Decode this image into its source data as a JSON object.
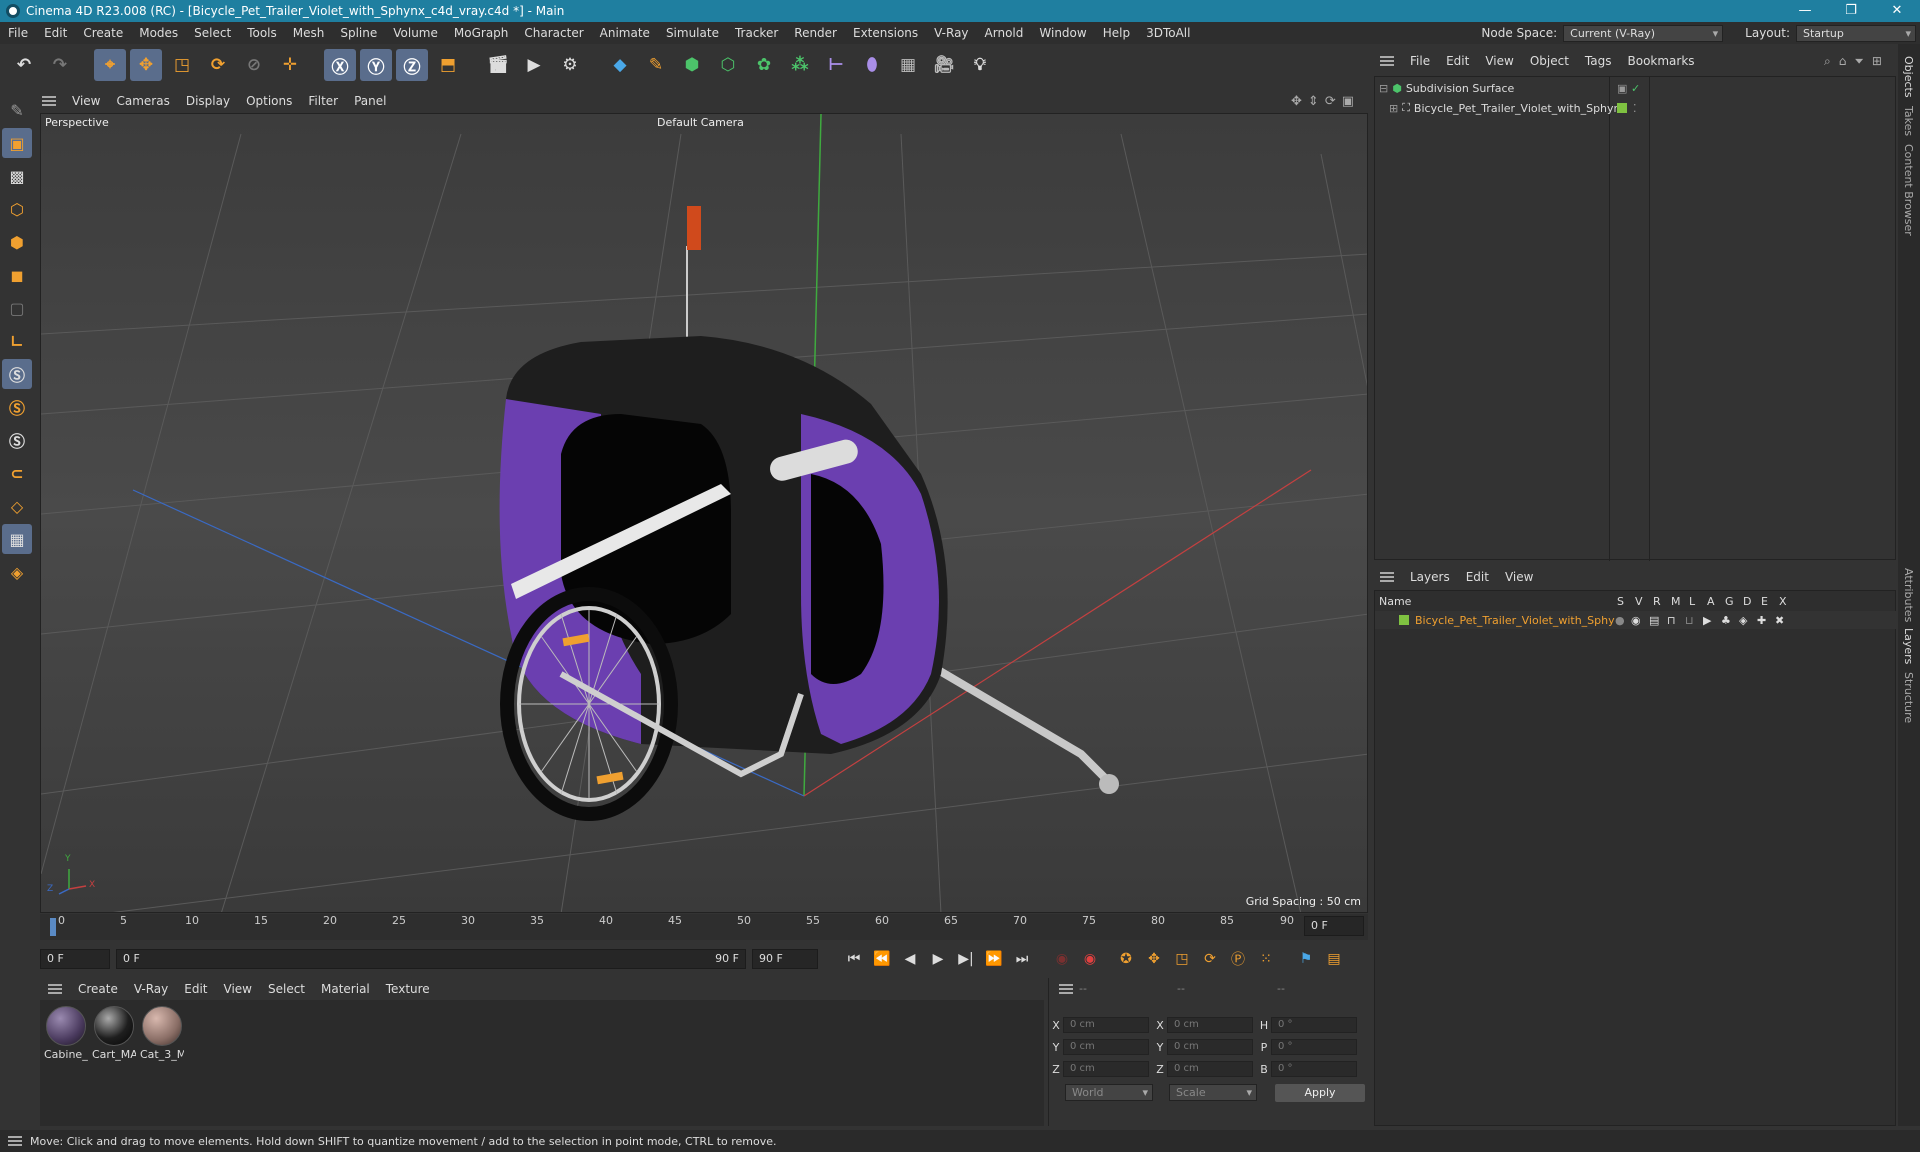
{
  "title": {
    "text": "Cinema 4D R23.008 (RC) - [Bicycle_Pet_Trailer_Violet_with_Sphynx_c4d_vray.c4d *] - Main"
  },
  "menubar": {
    "items": [
      "File",
      "Edit",
      "Create",
      "Modes",
      "Select",
      "Tools",
      "Mesh",
      "Spline",
      "Volume",
      "MoGraph",
      "Character",
      "Animate",
      "Simulate",
      "Tracker",
      "Render",
      "Extensions",
      "V-Ray",
      "Arnold",
      "Window",
      "Help",
      "3DToAll"
    ],
    "node_space_label": "Node Space:",
    "node_space_value": "Current (V-Ray)",
    "layout_label": "Layout:",
    "layout_value": "Startup"
  },
  "viewport": {
    "menu": [
      "View",
      "Cameras",
      "Display",
      "Options",
      "Filter",
      "Panel"
    ],
    "projection": "Perspective",
    "camera": "Default Camera",
    "grid_spacing": "Grid Spacing : 50 cm",
    "axis_x": "X",
    "axis_y": "Y",
    "axis_z": "Z"
  },
  "timeline": {
    "ticks": [
      "0",
      "5",
      "10",
      "15",
      "20",
      "25",
      "30",
      "35",
      "40",
      "45",
      "50",
      "55",
      "60",
      "65",
      "70",
      "75",
      "80",
      "85",
      "90"
    ],
    "current_frame": "0 F",
    "start": "0 F",
    "range_start": "0 F",
    "range_end": "90 F",
    "end": "90 F"
  },
  "materials": {
    "menu": [
      "Create",
      "V-Ray",
      "Edit",
      "View",
      "Select",
      "Material",
      "Texture"
    ],
    "items": [
      {
        "name": "Cabine_I",
        "color": "#4a3a5e"
      },
      {
        "name": "Cart_MA",
        "color": "#1e1e1e"
      },
      {
        "name": "Cat_3_M",
        "color": "#8a6e66"
      }
    ]
  },
  "coords": {
    "header": [
      "--",
      "--",
      "--"
    ],
    "rows": [
      {
        "a": "X",
        "av": "0 cm",
        "b": "X",
        "bv": "0 cm",
        "c": "H",
        "cv": "0 °"
      },
      {
        "a": "Y",
        "av": "0 cm",
        "b": "Y",
        "bv": "0 cm",
        "c": "P",
        "cv": "0 °"
      },
      {
        "a": "Z",
        "av": "0 cm",
        "b": "Z",
        "bv": "0 cm",
        "c": "B",
        "cv": "0 °"
      }
    ],
    "world": "World",
    "scale": "Scale",
    "apply": "Apply"
  },
  "objects": {
    "menu": [
      "File",
      "Edit",
      "View",
      "Object",
      "Tags",
      "Bookmarks"
    ],
    "items": [
      {
        "name": "Subdivision Surface",
        "indent": 0
      },
      {
        "name": "Bicycle_Pet_Trailer_Violet_with_Sphynx",
        "indent": 1
      }
    ]
  },
  "layers": {
    "menu": [
      "Layers",
      "Edit",
      "View"
    ],
    "header_name": "Name",
    "flags": [
      "S",
      "V",
      "R",
      "M",
      "L",
      "A",
      "G",
      "D",
      "E",
      "X"
    ],
    "items": [
      {
        "name": "Bicycle_Pet_Trailer_Violet_with_Sphynx",
        "color": "#7fc241"
      }
    ]
  },
  "sidetabs": [
    "Objects",
    "Takes",
    "Content Browser",
    "Attributes",
    "Layers",
    "Structure"
  ],
  "status": {
    "text": "Move: Click and drag to move elements. Hold down SHIFT to quantize movement / add to the selection in point mode, CTRL to remove."
  },
  "colors": {
    "accent": "#1f7fa0",
    "trailer": "#6b3fb0",
    "select": "#5a6d8c"
  }
}
